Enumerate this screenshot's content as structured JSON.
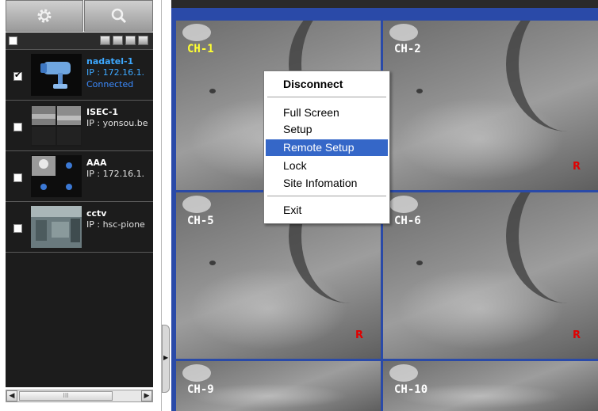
{
  "toolbar": {
    "gear_icon": "gear-icon",
    "search_icon": "search-icon"
  },
  "site_list": {
    "items": [
      {
        "name": "nadatel-1",
        "ip": "IP : 172.16.1.",
        "status": "Connected",
        "checked": true,
        "selected": true
      },
      {
        "name": "ISEC-1",
        "ip": "IP : yonsou.be",
        "status": "",
        "checked": false,
        "selected": false
      },
      {
        "name": "AAA",
        "ip": "IP : 172.16.1.",
        "status": "",
        "checked": false,
        "selected": false
      },
      {
        "name": "cctv",
        "ip": "IP : hsc-pione",
        "status": "",
        "checked": false,
        "selected": false
      }
    ]
  },
  "scrollbar": {
    "thumb_grip": "III"
  },
  "channels": [
    {
      "label": "CH-1",
      "rec": ""
    },
    {
      "label": "CH-2",
      "rec": "R"
    },
    {
      "label": "CH-5",
      "rec": "R"
    },
    {
      "label": "CH-6",
      "rec": "R"
    },
    {
      "label": "CH-9",
      "rec": ""
    },
    {
      "label": "CH-10",
      "rec": ""
    }
  ],
  "context_menu": {
    "disconnect": "Disconnect",
    "full_screen": "Full Screen",
    "setup": "Setup",
    "remote_setup": "Remote Setup",
    "lock": "Lock",
    "site_information": "Site Infomation",
    "exit": "Exit"
  },
  "colors": {
    "active_border": "#d01818",
    "highlight": "#3567c8",
    "rec": "#e00000",
    "connected": "#3b8bff"
  }
}
